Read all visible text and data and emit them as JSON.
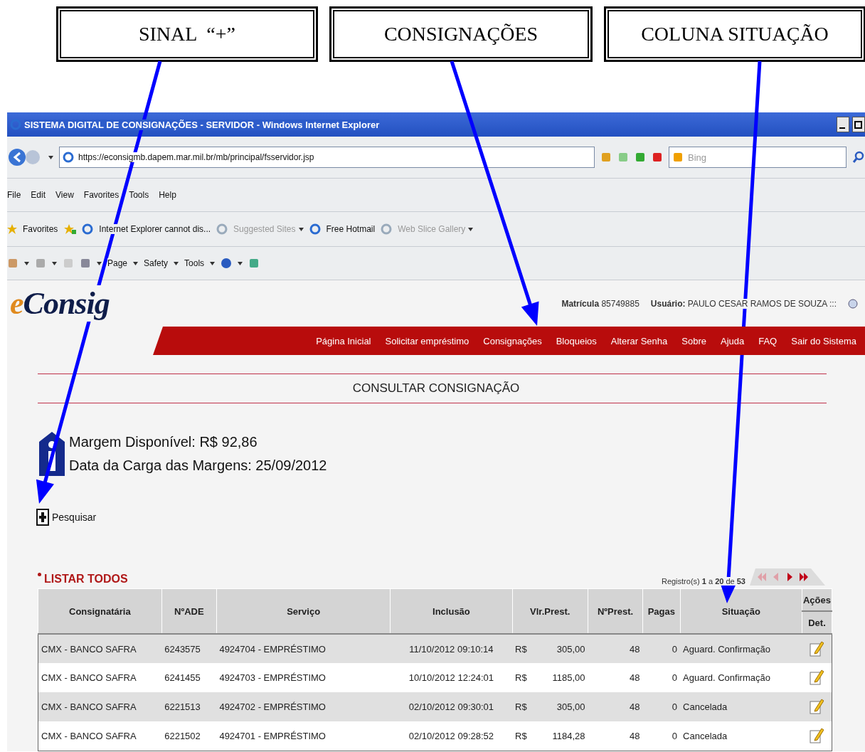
{
  "annotations": [
    {
      "label": "SINAL  “+”"
    },
    {
      "label": "CONSIGNAÇÕES"
    },
    {
      "label": "COLUNA SITUAÇÃO"
    }
  ],
  "browser": {
    "title": "SISTEMA DIGITAL DE CONSIGNAÇÕES - SERVIDOR - Windows Internet Explorer",
    "url": "https://econsigmb.dapem.mar.mil.br/mb/principal/fsservidor.jsp",
    "search_placeholder": "Bing",
    "menu": [
      "File",
      "Edit",
      "View",
      "Favorites",
      "Tools",
      "Help"
    ],
    "favorites_label": "Favorites",
    "favorites": [
      {
        "label": "Internet Explorer cannot dis...",
        "dropdown": false,
        "disabled": false
      },
      {
        "label": "Suggested Sites",
        "dropdown": true,
        "disabled": true
      },
      {
        "label": "Free Hotmail",
        "dropdown": false,
        "disabled": false
      },
      {
        "label": "Web Slice Gallery",
        "dropdown": true,
        "disabled": true
      }
    ],
    "commands": [
      "Page",
      "Safety",
      "Tools"
    ]
  },
  "page": {
    "logo": "eConsig",
    "user_info": [
      "**Matrícula** 85749885",
      "**Usuário:** PAULO CESAR RAMOS DE SOUZA :::"
    ],
    "nav": [
      {
        "label": "Página Inicial",
        "selected": false
      },
      {
        "label": "Solicitar empréstimo",
        "selected": false
      },
      {
        "label": "Consignações",
        "selected": false
      },
      {
        "label": "Bloqueios",
        "selected": false
      },
      {
        "label": "Alterar Senha",
        "selected": false
      },
      {
        "label": "Sobre",
        "selected": false
      },
      {
        "label": "Ajuda",
        "selected": false
      },
      {
        "label": "FAQ",
        "selected": false
      },
      {
        "label": "Sair do Sistema",
        "selected": false
      }
    ],
    "heading": "CONSULTAR CONSIGNAÇÃO",
    "info": [
      "Margem Disponível: R$ 92,86",
      "Data da Carga das Margens: 25/09/2012"
    ],
    "search_toggle": {
      "label": "Pesquisar",
      "expanded": false
    },
    "list_all": "LISTAR TODOS",
    "records": "Registro(s) **1** a **20** de **53**",
    "pager": [
      {
        "kind": "first",
        "disabled": true
      },
      {
        "kind": "prev",
        "disabled": true
      },
      {
        "kind": "next",
        "disabled": false
      },
      {
        "kind": "last",
        "disabled": false
      }
    ],
    "table": {
      "columns": [
        "Consignatária",
        "NºADE",
        "Serviço",
        "Inclusão",
        "Vlr.Prest.",
        "NºPrest.",
        "Pagas",
        "Situação"
      ],
      "actions_heading": "Ações",
      "actions_sub": "Det.",
      "rows": [
        {
          "consignataria": "CMX - BANCO SAFRA",
          "ade": "6243575",
          "servico": "4924704 - EMPRÉSTIMO",
          "inclusao": "11/10/2012 09:10:14",
          "currency": "R$",
          "valor": "305,00",
          "prestacoes": "48",
          "pagas": "0",
          "situacao": "Aguard. Confirmação"
        },
        {
          "consignataria": "CMX - BANCO SAFRA",
          "ade": "6241455",
          "servico": "4924703 - EMPRÉSTIMO",
          "inclusao": "10/10/2012 12:24:01",
          "currency": "R$",
          "valor": "1185,00",
          "prestacoes": "48",
          "pagas": "0",
          "situacao": "Aguard. Confirmação"
        },
        {
          "consignataria": "CMX - BANCO SAFRA",
          "ade": "6221513",
          "servico": "4924702 - EMPRÉSTIMO",
          "inclusao": "02/10/2012 09:30:01",
          "currency": "R$",
          "valor": "305,00",
          "prestacoes": "48",
          "pagas": "0",
          "situacao": "Cancelada"
        },
        {
          "consignataria": "CMX - BANCO SAFRA",
          "ade": "6221502",
          "servico": "4924701 - EMPRÉSTIMO",
          "inclusao": "02/10/2012 09:28:52",
          "currency": "R$",
          "valor": "1184,28",
          "prestacoes": "48",
          "pagas": "0",
          "situacao": "Cancelada"
        }
      ]
    }
  }
}
